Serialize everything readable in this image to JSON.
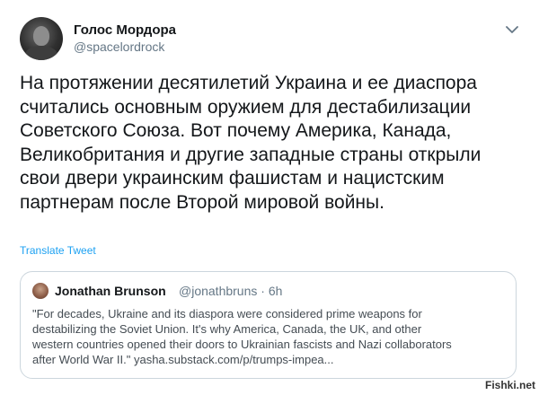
{
  "tweet": {
    "author": {
      "display_name": "Голос Мордора",
      "handle": "@spacelordrock",
      "avatar_icon": "user-avatar"
    },
    "menu_icon": "chevron-down-icon",
    "text": "На протяжении десятилетий Украина и ее диаспора\nсчитались основным оружием для дестабилизации\nСоветского Союза. Вот почему Америка, Канада,\nВеликобритания и другие западные страны открыли\nсвои двери украинским фашистам и нацистским\nпартнерам после Второй мировой войны.",
    "translate_label": "Translate Tweet"
  },
  "quote": {
    "display_name": "Jonathan Brunson",
    "handle_time": "@jonathbruns · 6h",
    "text": "\"For decades, Ukraine and its diaspora were considered prime weapons for\ndestabilizing the Soviet Union. It's why America, Canada, the UK, and other\nwestern countries opened their doors to Ukrainian fascists and Nazi collaborators\nafter World War II.\" yasha.substack.com/p/trumps-impea..."
  },
  "watermark": "Fishki.net",
  "colors": {
    "link": "#1da1f2",
    "secondary_text": "#657786",
    "primary_text": "#14171a",
    "border": "#ccd6dd"
  }
}
